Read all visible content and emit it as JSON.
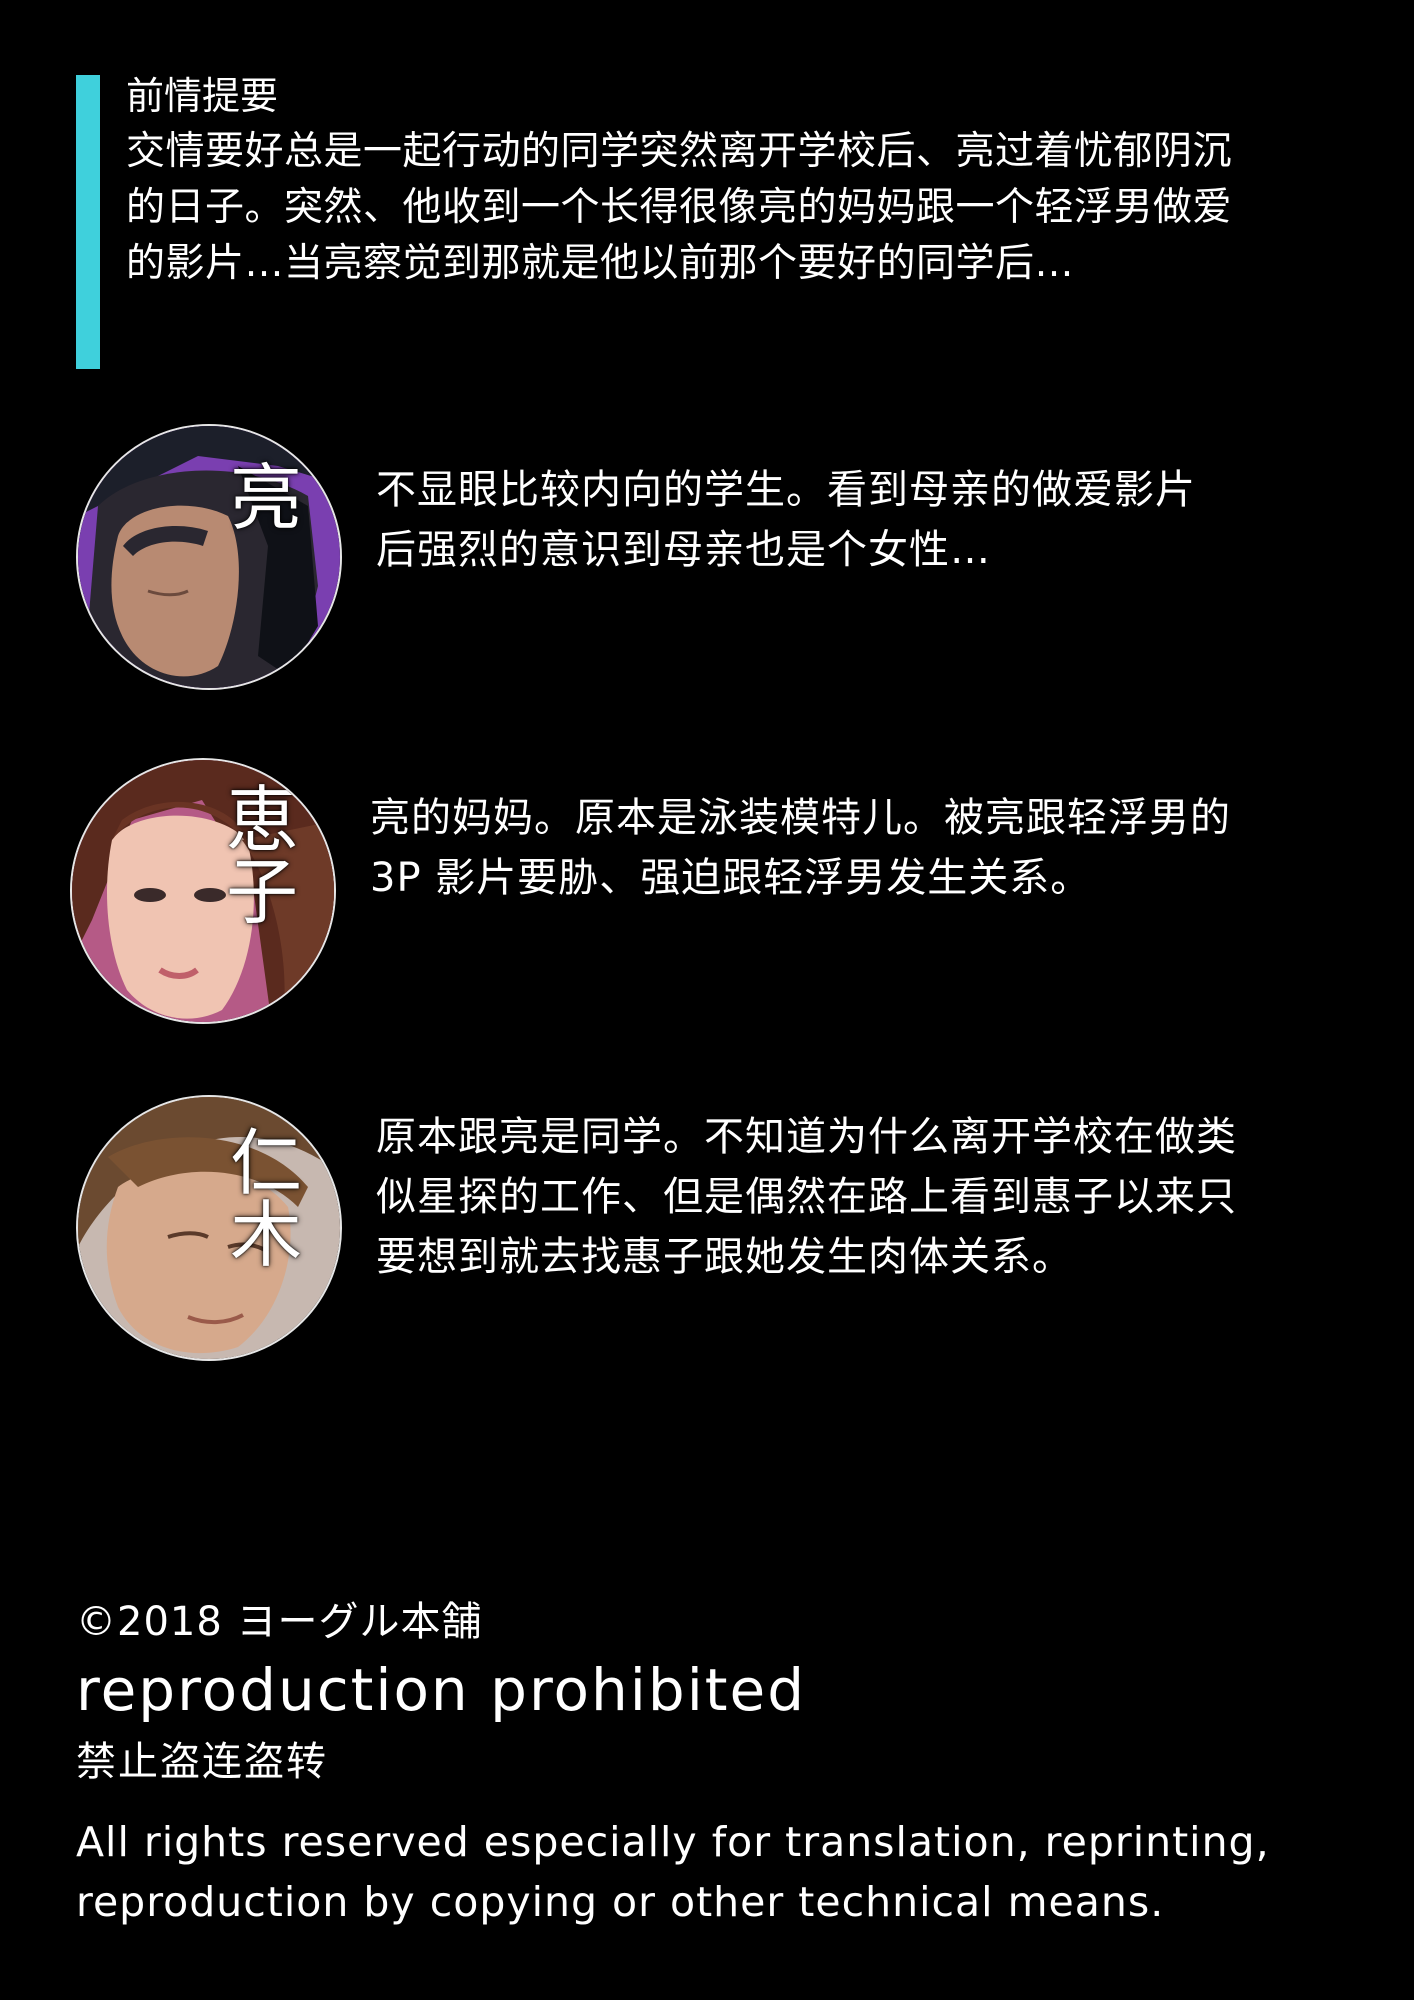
{
  "summary": {
    "heading": "前情提要",
    "lines": [
      "交情要好总是一起行动的同学突然离开学校后、亮过着忧郁阴沉",
      "的日子。突然、他收到一个长得很像亮的妈妈跟一个轻浮男做爱",
      "的影片…当亮察觉到那就是他以前那个要好的同学后…"
    ],
    "accent_color": "#3fd0dc"
  },
  "characters": [
    {
      "name": "亮",
      "lines": [
        "不显眼比较内向的学生。看到母亲的做爱影片",
        "后强烈的意识到母亲也是个女性…"
      ],
      "bg_color": "#7a3fb0"
    },
    {
      "name": "恵子",
      "name_chars": [
        "恵",
        "子"
      ],
      "lines": [
        "亮的妈妈。原本是泳装模特儿。被亮跟轻浮男的",
        "3P 影片要胁、强迫跟轻浮男发生关系。"
      ],
      "bg_color": "#b55a86"
    },
    {
      "name": "仁木",
      "name_chars": [
        "仁",
        "木"
      ],
      "lines": [
        "原本跟亮是同学。不知道为什么离开学校在做类",
        "似星探的工作、但是偶然在路上看到惠子以来只",
        "要想到就去找惠子跟她发生肉体关系。"
      ],
      "bg_color": "#c7b8b0"
    }
  ],
  "footer": {
    "copyright": "©2018 ヨーグル本舗",
    "prohibited": "reproduction prohibited",
    "cn_notice": "禁止盗连盗转",
    "rights_lines": [
      "All rights reserved especially for translation, reprinting,",
      "reproduction by copying or other technical means."
    ]
  }
}
